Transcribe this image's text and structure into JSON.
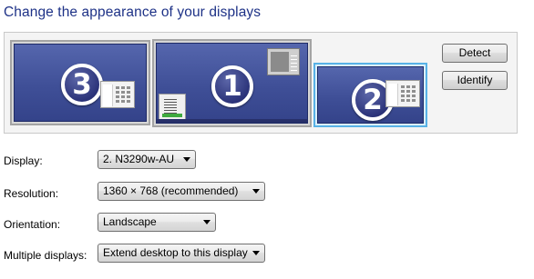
{
  "title": "Change the appearance of your displays",
  "monitors": [
    {
      "number": "3",
      "selected": false
    },
    {
      "number": "1",
      "selected": false
    },
    {
      "number": "2",
      "selected": true
    }
  ],
  "buttons": {
    "detect": "Detect",
    "identify": "Identify"
  },
  "fields": {
    "display": {
      "label": "Display:",
      "value": "2. N3290w-AU"
    },
    "resolution": {
      "label": "Resolution:",
      "value": "1360 × 768 (recommended)"
    },
    "orientation": {
      "label": "Orientation:",
      "value": "Landscape"
    },
    "multiple_displays": {
      "label": "Multiple displays:",
      "value": "Extend desktop to this display"
    }
  },
  "colors": {
    "title": "#1e3287",
    "screen": "#4a5aa4",
    "selected_border": "#58b2e6"
  },
  "icons": [
    "window-thumbnail-icon",
    "sidebar-gadget-icon",
    "dropdown-arrow-icon"
  ]
}
